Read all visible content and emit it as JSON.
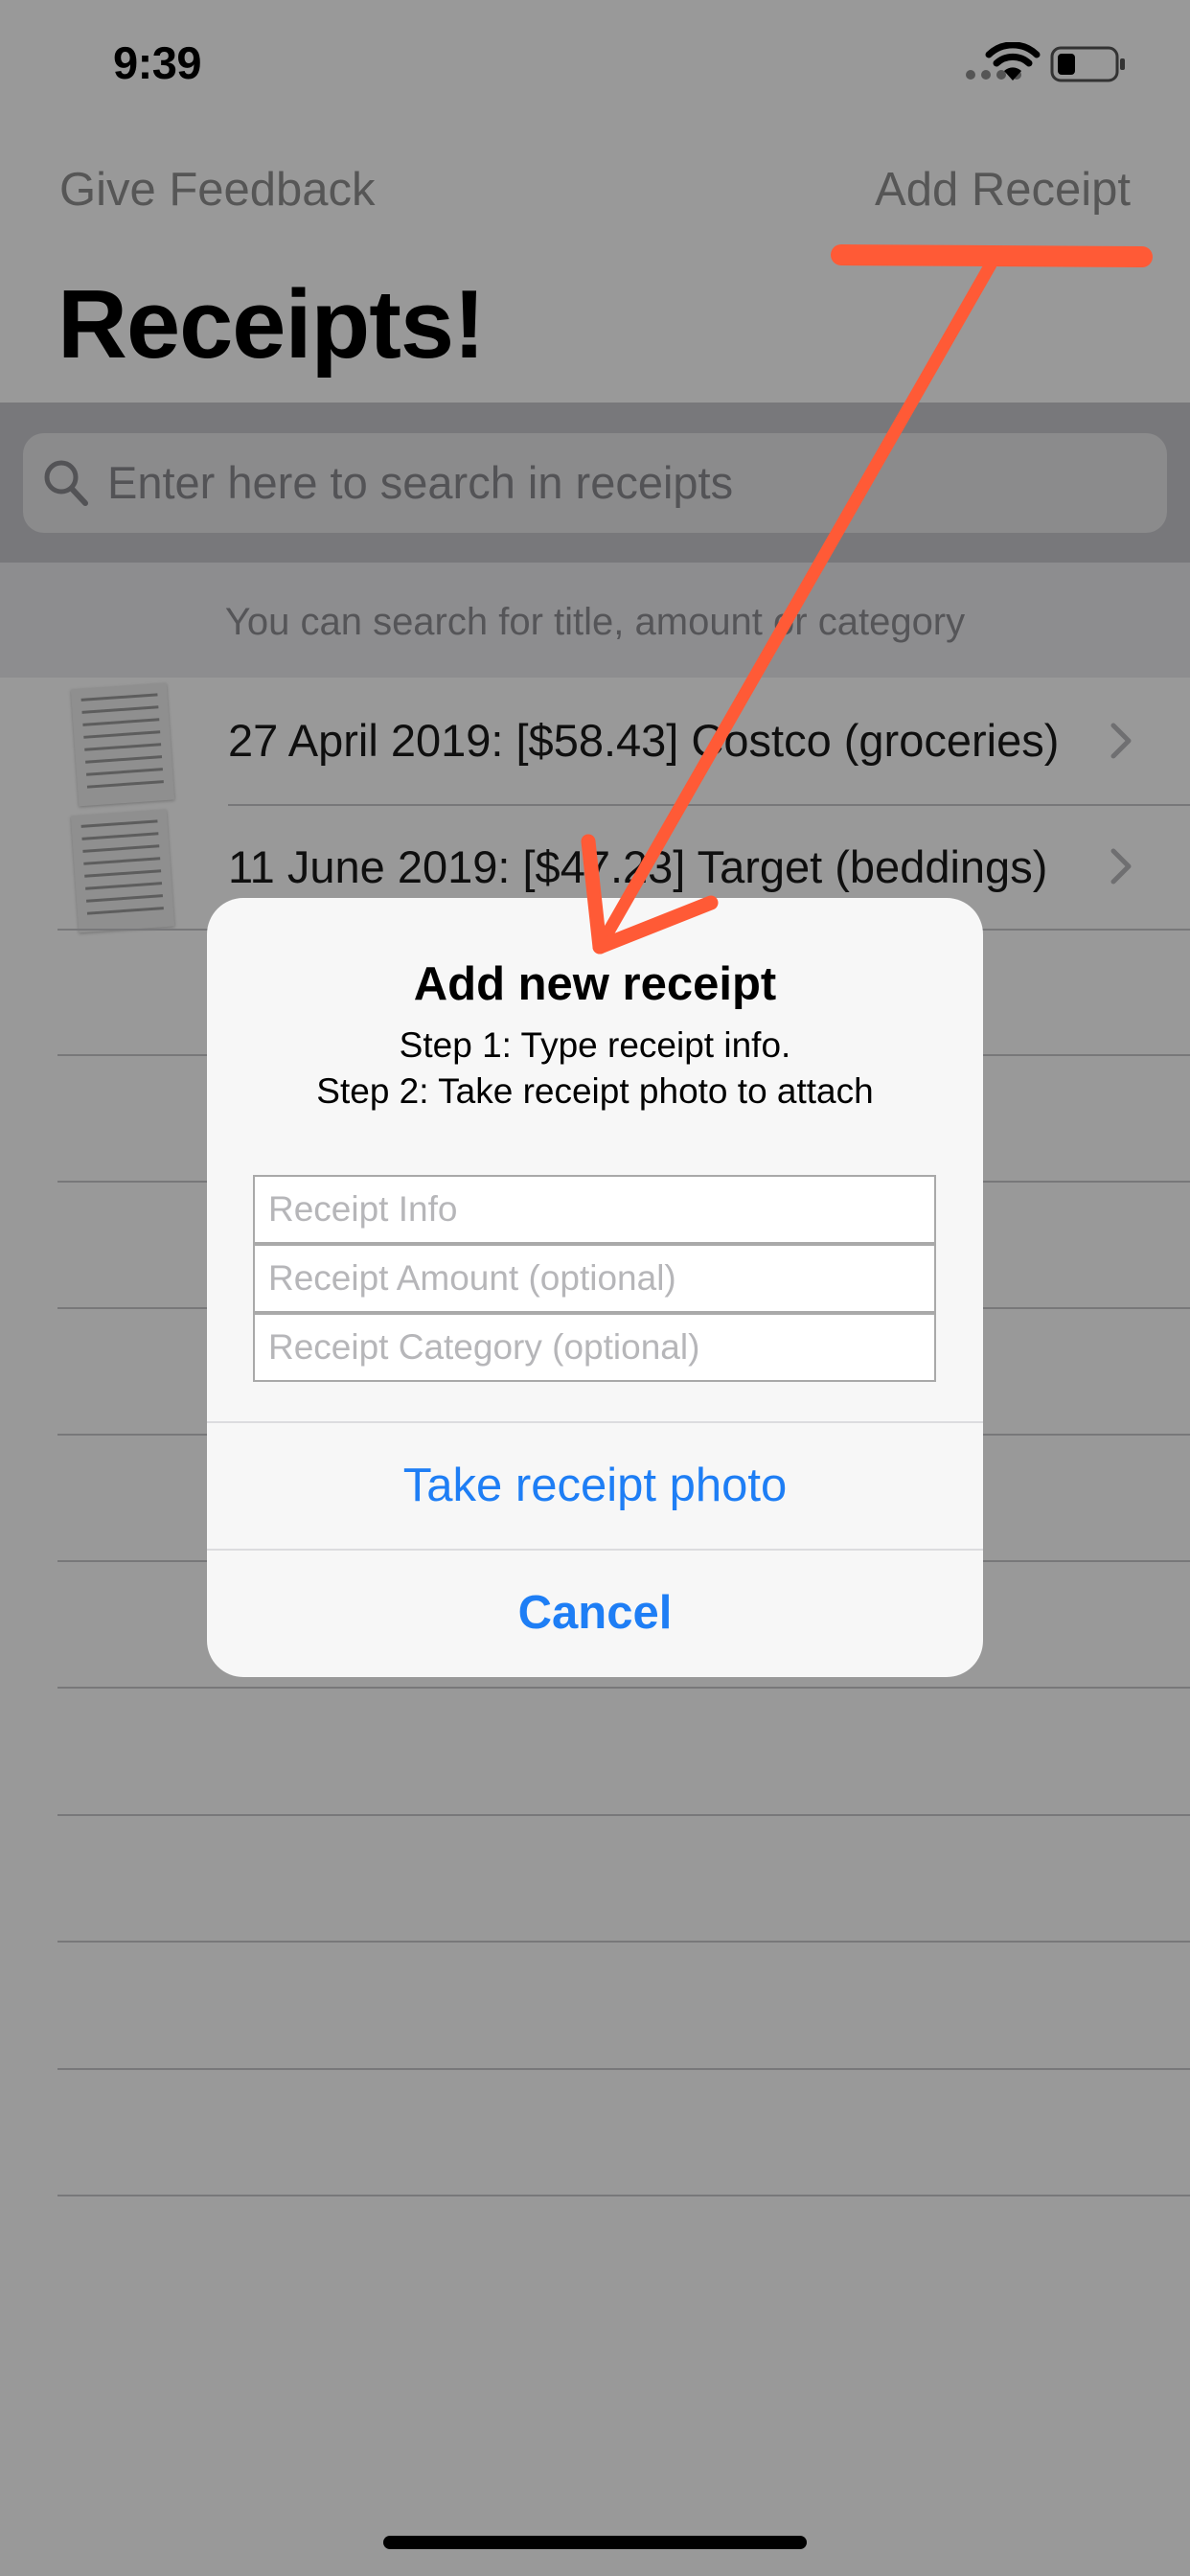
{
  "status_bar": {
    "time": "9:39"
  },
  "nav": {
    "left_label": "Give Feedback",
    "right_label": "Add Receipt",
    "title": "Receipts!"
  },
  "search": {
    "placeholder": "Enter here to search in receipts",
    "hint": "You can search for title, amount or category"
  },
  "list": {
    "items": [
      {
        "label": "27 April 2019: [$58.43] Costco (groceries)"
      },
      {
        "label": "11 June 2019: [$47.23] Target (beddings)"
      }
    ]
  },
  "alert": {
    "title": "Add new receipt",
    "message_line1": "Step 1: Type receipt info.",
    "message_line2": "Step 2: Take receipt photo to attach",
    "fields": [
      {
        "placeholder": "Receipt Info"
      },
      {
        "placeholder": "Receipt Amount (optional)"
      },
      {
        "placeholder": "Receipt Category (optional)"
      }
    ],
    "primary_button": "Take receipt photo",
    "cancel_button": "Cancel"
  },
  "colors": {
    "accent": "#1e7ef5",
    "annotation": "#ff5a36"
  }
}
